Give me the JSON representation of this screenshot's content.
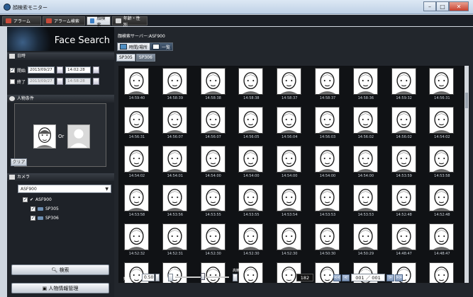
{
  "window": {
    "title": "顔検索モニター"
  },
  "top_tabs": [
    {
      "label": "アラーム",
      "color": "#c94b3a"
    },
    {
      "label": "アラーム検索",
      "color": "#c94b3a"
    },
    {
      "label": "顔検索",
      "color": "#3d7fc4"
    },
    {
      "label": "年齢・性別",
      "color": "#d8d8d8"
    }
  ],
  "left": {
    "banner": "Face Search",
    "datetime": {
      "header": "日時",
      "start_label": "開始",
      "start_date": "2013/09/27",
      "start_time": "14:02:28",
      "end_label": "終了",
      "end_date": "2013/09/27",
      "end_time": "14:58:28"
    },
    "person": {
      "header": "人物条件",
      "or_text": "Or",
      "clear": "クリア"
    },
    "camera": {
      "header": "カメラ",
      "selected": "ASF900",
      "tree": [
        "ASF900",
        "SP305",
        "SP306"
      ]
    },
    "search_button": "検索",
    "manage_button": "人物情報管理"
  },
  "main": {
    "server_line": "顔検索サーバー:ASF900",
    "view_tabs": [
      "時間/場所",
      "一覧"
    ],
    "server_tabs": [
      "SP305",
      "SP306"
    ],
    "timestamps": [
      [
        "14:59:40",
        "14:58:39",
        "14:58:38",
        "14:58:38",
        "14:58:37",
        "14:58:37",
        "14:58:36",
        "14:59:32",
        "14:56:31"
      ],
      [
        "14:56:31",
        "14:56:07",
        "14:56:07",
        "14:56:05",
        "14:56:04",
        "14:56:03",
        "14:56:02",
        "14:56:02",
        "14:54:02"
      ],
      [
        "14:54:02",
        "14:54:01",
        "14:54:00",
        "14:54:00",
        "14:54:00",
        "14:54:00",
        "14:54:00",
        "14:53:59",
        "14:53:58"
      ],
      [
        "14:53:58",
        "14:53:56",
        "14:53:55",
        "14:53:55",
        "14:53:54",
        "14:53:53",
        "14:53:53",
        "14:52:48",
        "14:52:48"
      ],
      [
        "14:52:32",
        "14:52:31",
        "14:52:30",
        "14:52:30",
        "14:52:30",
        "14:50:30",
        "14:50:29",
        "14:48:47",
        "14:48:47"
      ],
      [
        "",
        "",
        "",
        "",
        "",
        "",
        "",
        "",
        ""
      ]
    ],
    "bottom": {
      "similarity_label": "類似度",
      "similarity_value": "0.50",
      "low_label": "低精",
      "high_label": "高精",
      "count_label": "件数",
      "count_value": "182",
      "count_unit": "件",
      "page_label": "ページ",
      "page_value": "001 ／ 001",
      "nav": [
        "<<",
        "<",
        ">",
        ">>"
      ]
    }
  }
}
